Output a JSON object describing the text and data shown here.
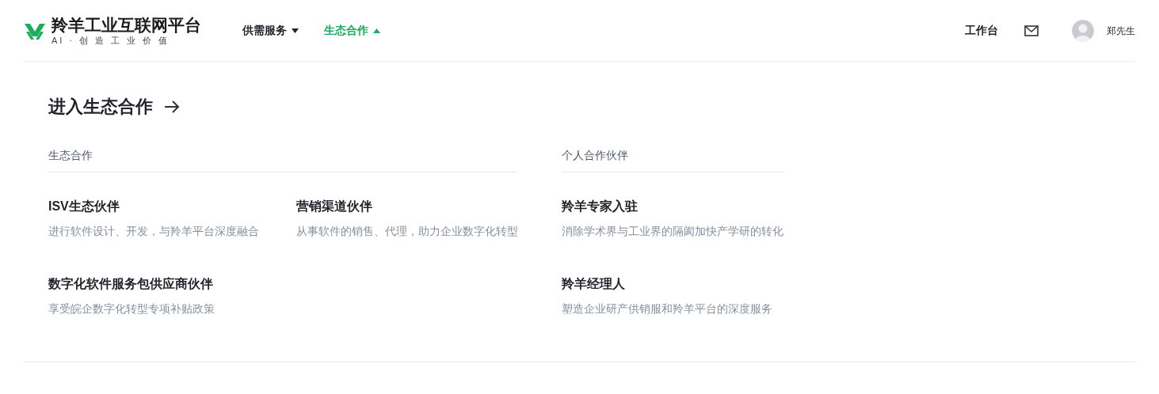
{
  "logo": {
    "title": "羚羊工业互联网平台",
    "slogan": "AI · 创 造 工 业 价 值"
  },
  "nav": [
    {
      "label": "供需服务",
      "selected": false,
      "expanded": false
    },
    {
      "label": "生态合作",
      "selected": true,
      "expanded": true
    }
  ],
  "header_right": {
    "workbench": "工作台",
    "user": "郑先生"
  },
  "panel": {
    "title": "进入生态合作",
    "groups": [
      {
        "title": "生态合作",
        "kind": "grid",
        "items": [
          {
            "title": "ISV生态伙伴",
            "desc": "进行软件设计、开发，与羚羊平台深度融合"
          },
          {
            "title": "营销渠道伙伴",
            "desc": "从事软件的销售、代理，助力企业数字化转型"
          },
          {
            "title": "数字化软件服务包供应商伙伴",
            "desc": "享受皖企数字化转型专项补贴政策"
          }
        ]
      },
      {
        "title": "个人合作伙伴",
        "kind": "list",
        "items": [
          {
            "title": "羚羊专家入驻",
            "desc": "消除学术界与工业界的隔阂加快产学研的转化"
          },
          {
            "title": "羚羊经理人",
            "desc": "塑造企业研产供销服和羚羊平台的深度服务"
          }
        ]
      }
    ]
  }
}
